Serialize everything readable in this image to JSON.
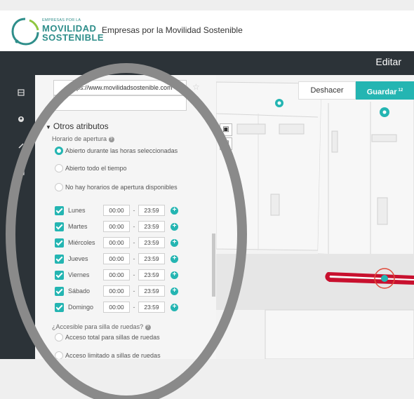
{
  "header": {
    "logo_line1": "EMPRESAS POR LA",
    "logo_line2": "MOVILIDAD",
    "logo_line3": "SOSTENIBLE",
    "app_title": "Empresas por la Movilidad Sostenible"
  },
  "topbar": {
    "mode_label": "Editar"
  },
  "toolbar": {
    "undo_label": "Deshacer",
    "save_label": "Guardar",
    "save_count": "12"
  },
  "panel": {
    "website_value": "https://www.movilidadsostenible.com",
    "section_title": "Otros atributos",
    "hours_label": "Horario de apertura",
    "hours_options": [
      {
        "label": "Abierto durante las horas seleccionadas",
        "selected": true
      },
      {
        "label": "Abierto todo el tiempo",
        "selected": false
      },
      {
        "label": "No hay horarios de apertura disponibles",
        "selected": false
      }
    ],
    "days": [
      {
        "name": "Lunes",
        "from": "00:00",
        "to": "23:59",
        "checked": true
      },
      {
        "name": "Martes",
        "from": "00:00",
        "to": "23:59",
        "checked": true
      },
      {
        "name": "Miércoles",
        "from": "00:00",
        "to": "23:59",
        "checked": true
      },
      {
        "name": "Jueves",
        "from": "00:00",
        "to": "23:59",
        "checked": true
      },
      {
        "name": "Viernes",
        "from": "00:00",
        "to": "23:59",
        "checked": true
      },
      {
        "name": "Sábado",
        "from": "00:00",
        "to": "23:59",
        "checked": true
      },
      {
        "name": "Domingo",
        "from": "00:00",
        "to": "23:59",
        "checked": true
      }
    ],
    "wheelchair_label": "¿Accesible para silla de ruedas?",
    "wheelchair_options": [
      {
        "label": "Acceso total para sillas de ruedas",
        "selected": false
      },
      {
        "label": "Acceso limitado a sillas de ruedas",
        "selected": false
      }
    ]
  },
  "colors": {
    "accent": "#24b5b2",
    "dark_bar": "#2c3338",
    "route_red": "#c8102e",
    "overlay_grey": "#8a8a8a"
  }
}
